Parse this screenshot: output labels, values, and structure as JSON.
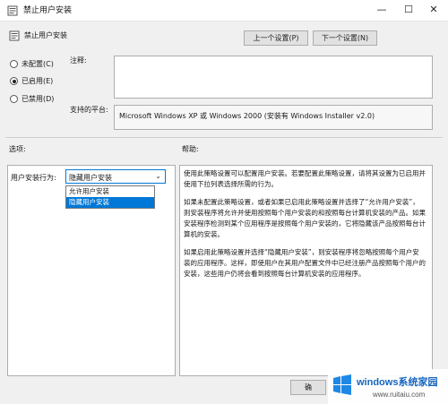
{
  "window": {
    "title": "禁止用户安装"
  },
  "header": {
    "policy_title": "禁止用户安装",
    "prev_button": "上一个设置(P)",
    "next_button": "下一个设置(N)"
  },
  "state": {
    "options": [
      {
        "label": "未配置(C)",
        "selected": false
      },
      {
        "label": "已启用(E)",
        "selected": true
      },
      {
        "label": "已禁用(D)",
        "selected": false
      }
    ]
  },
  "comment": {
    "label": "注释:",
    "value": ""
  },
  "platform": {
    "label": "支持的平台:",
    "value": "Microsoft Windows XP 或 Windows 2000 (安装有 Windows Installer v2.0)"
  },
  "options_section": {
    "label": "选项:",
    "user_install_label": "用户安装行为:",
    "selected": "隐藏用户安装",
    "dropdown_options": [
      "允许用户安装",
      "隐藏用户安装"
    ]
  },
  "help": {
    "label": "帮助:",
    "paragraphs": [
      "使用此策略设置可以配置用户安装。若要配置此策略设置，请将其设置为已启用并使用下拉列表选择所需的行为。",
      "如果未配置此策略设置，或者如果已启用此策略设置并选择了“允许用户安装”，则安装程序将允许并使用按照每个用户安装的和按照每台计算机安装的产品。如果安装程序检测到某个应用程序是按照每个用户安装的，它将隐藏该产品按照每台计算机的安装。",
      "如果启用此策略设置并选择“隐藏用户安装”，则安装程序将忽略按照每个用户安装的应用程序。这样，即使用户在其用户配置文件中已经注册产品按照每个用户的安装，这些用户仍将会看到按照每台计算机安装的应用程序。"
    ]
  },
  "footer": {
    "ok_button": "确"
  },
  "watermark": {
    "text": "windows系统家园",
    "url": "www.ruitaiu.com"
  }
}
